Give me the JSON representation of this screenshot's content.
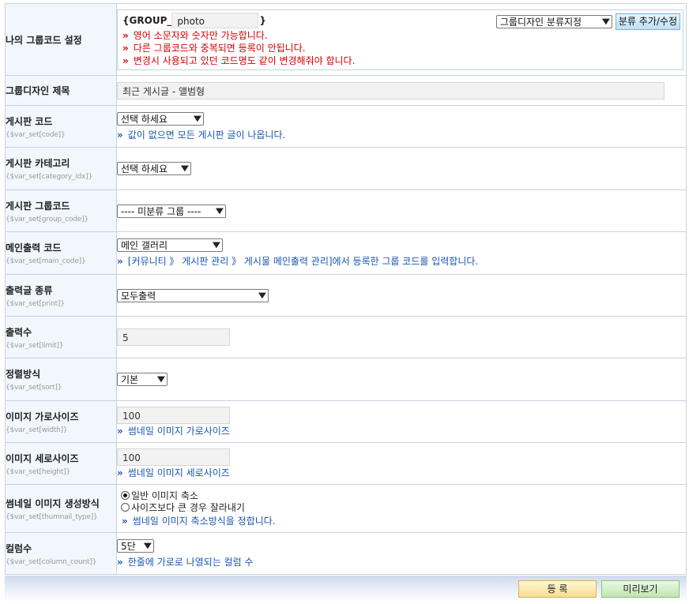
{
  "group_code": {
    "label": "나의 그룹코드 설정",
    "prefix": "{GROUP_",
    "value": "photo",
    "suffix": "}",
    "category_select": "그룹디자인 분류지정",
    "add_button": "분류 추가/수정",
    "warning_marker": "»",
    "warnings": [
      "영어 소문자와 숫자만 가능합니다.",
      "다른 그룹코드와 중복되면 등록이 안됩니다.",
      "변경시 사용되고 있던 코드명도 같이 변경해줘야 합니다."
    ]
  },
  "title_row": {
    "label": "그룹디자인 제목",
    "value": "최근 게시글 - 앨범형"
  },
  "rows": {
    "board_code": {
      "label": "게시판 코드",
      "var": "{$var_set[code]}",
      "select": "선택 하세요",
      "hint": "값이 없으면 모든 게시판 글이 나옵니다."
    },
    "board_category": {
      "label": "게시판 카테고리",
      "var": "{$var_set[category_idx]}",
      "select": "선택 하세요"
    },
    "board_group": {
      "label": "게시판 그룹코드",
      "var": "{$var_set[group_code]}",
      "select": "---- 미분류 그룹 ----"
    },
    "main_code": {
      "label": "메인출력 코드",
      "var": "{$var_set[main_code]}",
      "select": "메인 갤러리",
      "hint": "[커뮤니티 》 게시판 관리 》 게시물 메인출력 관리]에서 등록한 그룹 코드를 입력합니다."
    },
    "print_type": {
      "label": "출력글 종류",
      "var": "{$var_set[print]}",
      "select": "모두출력"
    },
    "limit": {
      "label": "출력수",
      "var": "{$var_set[limit]}",
      "value": "5"
    },
    "sort": {
      "label": "정렬방식",
      "var": "{$var_set[sort]}",
      "select": "기본"
    },
    "width": {
      "label": "이미지 가로사이즈",
      "var": "{$var_set[width]}",
      "value": "100",
      "hint": "썸네일 이미지 가로사이즈"
    },
    "height": {
      "label": "이미지 세로사이즈",
      "var": "{$var_set[height]}",
      "value": "100",
      "hint": "썸네일 이미지 세로사이즈"
    },
    "thumb_type": {
      "label": "썸네일 이미지 생성방식",
      "var": "{$var_set[thumnail_type]}",
      "option1": "일반 이미지 축소",
      "option2": "사이즈보다 큰 경우 잘라내기",
      "hint": "썸네일 이미지 축소방식을 정합니다."
    },
    "columns": {
      "label": "컬럼수",
      "var": "{$var_set[column_count]}",
      "select": "5단",
      "hint": "한줄에 가로로 나열되는 컬럼 수"
    }
  },
  "hint_marker": "»",
  "buttons": {
    "register": "등 록",
    "preview": "미리보기"
  },
  "colors": {
    "label_bg": "#f1f7fd",
    "hint": "#1a56b0",
    "warning": "#d40000",
    "border": "#c9d2dc"
  }
}
